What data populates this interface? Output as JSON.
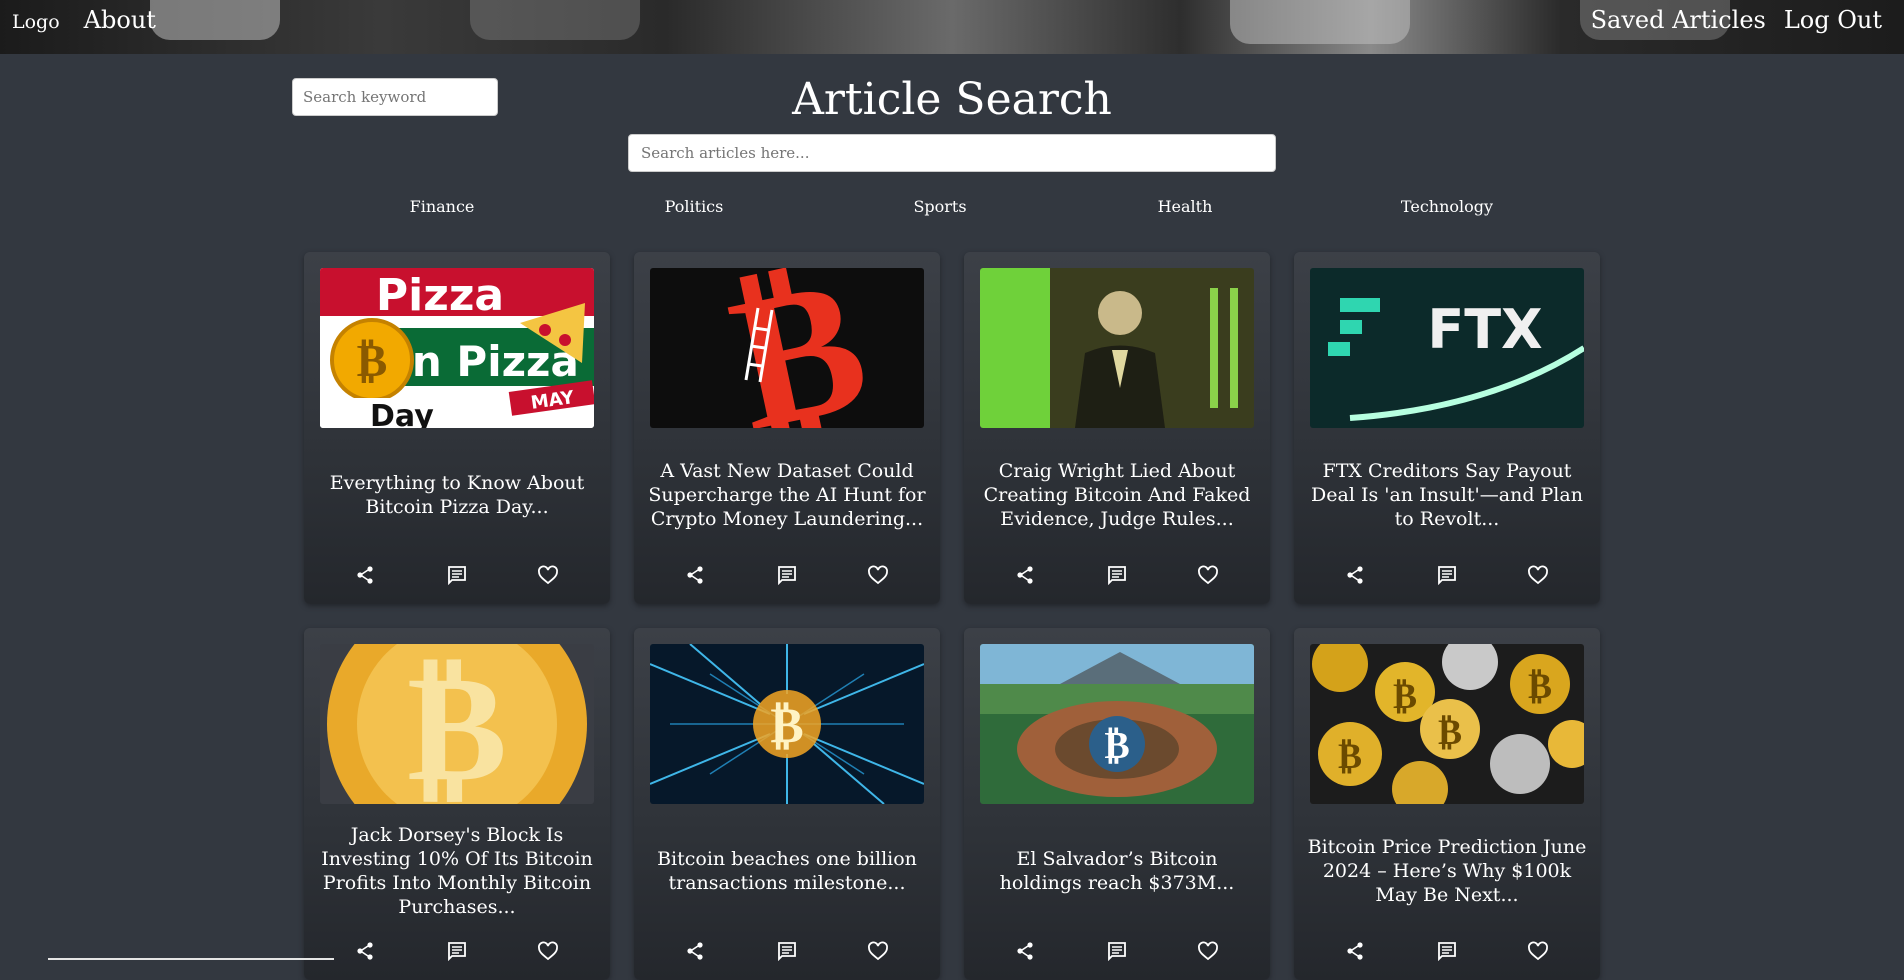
{
  "nav": {
    "logo": "Logo",
    "about": "About",
    "saved": "Saved Articles",
    "logout": "Log Out"
  },
  "keyword_search": {
    "placeholder": "Search keyword"
  },
  "page_title": "Article Search",
  "article_search": {
    "placeholder": "Search articles here..."
  },
  "categories": [
    "Finance",
    "Politics",
    "Sports",
    "Health",
    "Technology"
  ],
  "articles": [
    {
      "title": "Everything to Know About Bitcoin Pizza Day...",
      "image": "Bitcoin Pizza Day"
    },
    {
      "title": "A Vast New Dataset Could Supercharge the AI Hunt for Crypto Money Laundering...",
      "image": ""
    },
    {
      "title": "Craig Wright Lied About Creating Bitcoin And Faked Evidence, Judge Rules...",
      "image": ""
    },
    {
      "title": "FTX Creditors Say Payout Deal Is 'an Insult'—and Plan to Revolt...",
      "image": "FTX"
    },
    {
      "title": "Jack Dorsey's Block Is Investing 10% Of Its Bitcoin Profits Into Monthly Bitcoin Purchases...",
      "image": ""
    },
    {
      "title": "Bitcoin beaches one billion transactions milestone...",
      "image": ""
    },
    {
      "title": "El Salvador’s Bitcoin holdings reach $373M...",
      "image": ""
    },
    {
      "title": "Bitcoin Price Prediction June 2024 – Here’s Why $100k May Be Next...",
      "image": ""
    }
  ],
  "icons": {
    "share": "share-icon",
    "comment": "comment-icon",
    "like": "heart-icon"
  },
  "colors": {
    "background": "#333840",
    "card": "#2f3339",
    "text": "#ffffff"
  }
}
